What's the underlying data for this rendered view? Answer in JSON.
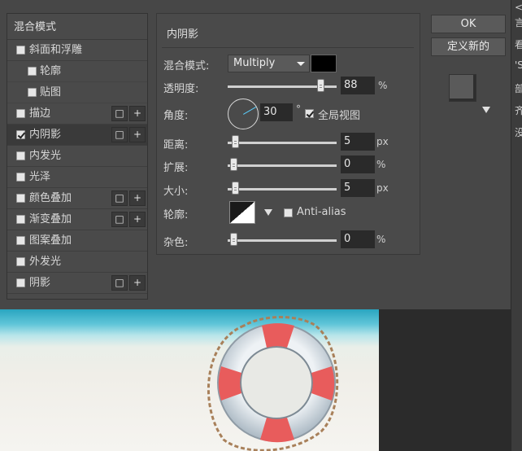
{
  "style_list": {
    "header": "混合模式",
    "items": [
      {
        "label": "斜面和浮雕",
        "checked": false,
        "sub": false,
        "buttons": false
      },
      {
        "label": "轮廓",
        "checked": false,
        "sub": true,
        "buttons": false
      },
      {
        "label": "贴图",
        "checked": false,
        "sub": true,
        "buttons": false
      },
      {
        "label": "描边",
        "checked": false,
        "sub": false,
        "buttons": true
      },
      {
        "label": "内阴影",
        "checked": true,
        "sub": false,
        "buttons": true,
        "active": true
      },
      {
        "label": "内发光",
        "checked": false,
        "sub": false,
        "buttons": false
      },
      {
        "label": "光泽",
        "checked": false,
        "sub": false,
        "buttons": false
      },
      {
        "label": "颜色叠加",
        "checked": false,
        "sub": false,
        "buttons": true
      },
      {
        "label": "渐变叠加",
        "checked": false,
        "sub": false,
        "buttons": true
      },
      {
        "label": "图案叠加",
        "checked": false,
        "sub": false,
        "buttons": false
      },
      {
        "label": "外发光",
        "checked": false,
        "sub": false,
        "buttons": false
      },
      {
        "label": "阴影",
        "checked": false,
        "sub": false,
        "buttons": true
      }
    ],
    "btn_square": "□",
    "btn_plus": "+"
  },
  "panel": {
    "title": "内阴影",
    "blend_mode_label": "混合模式:",
    "blend_mode_value": "Multiply",
    "shadow_color": "#000000",
    "opacity_label": "透明度:",
    "opacity_value": "88",
    "opacity_unit": "%",
    "opacity_level": 0.88,
    "angle_label": "角度:",
    "angle_value": "30",
    "angle_unit": "°",
    "global_light_label": "全局视图",
    "global_light_checked": true,
    "distance_label": "距离:",
    "distance_value": "5",
    "distance_unit": "px",
    "spread_label": "扩展:",
    "spread_value": "0",
    "spread_unit": "%",
    "size_label": "大小:",
    "size_value": "5",
    "size_unit": "px",
    "contour_label": "轮廓:",
    "antialias_label": "Anti-alias",
    "antialias_checked": false,
    "noise_label": "杂色:",
    "noise_value": "0",
    "noise_unit": "%"
  },
  "actions": {
    "ok_label": "OK",
    "new_style_label": "定义新的"
  },
  "right_strip": [
    "<",
    "言",
    "看",
    "'S",
    "部",
    "齐",
    "没"
  ],
  "colors": {
    "dialog_bg": "#474747",
    "panel_bg": "#4a4a4a",
    "accent": "#5ad0ff"
  }
}
